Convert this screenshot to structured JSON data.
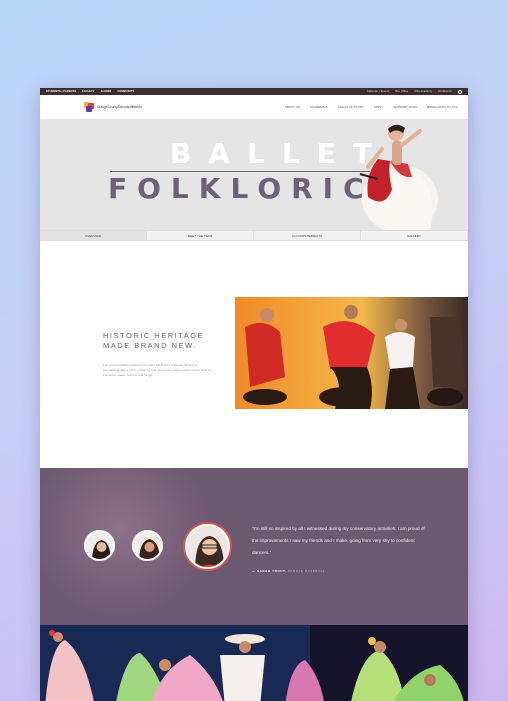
{
  "util_bar": {
    "left": [
      "Students | Parents",
      "Faculty",
      "Alumni",
      "Community"
    ],
    "right": [
      "Calendar / Events",
      "Box Office",
      "OSA Academy",
      "Workbench"
    ]
  },
  "nav": {
    "logo_text": "OrangeCountySchoolsoftheArts",
    "links": [
      "About Us",
      "Academics",
      "Areas of Study",
      "Apply",
      "Support OCSA",
      "Bring OCSA to You"
    ]
  },
  "hero": {
    "title_line1": "BALLET",
    "title_line2": "FOLKLORICO"
  },
  "tabs": [
    "Overview",
    "Meet the Team",
    "Accomplishments",
    "Gallery"
  ],
  "heritage": {
    "heading_line1": "Historic Heritage",
    "heading_line2": "Made Brand New.",
    "body": "The enriched Ballet Folklorico Program will feature a diverse offering of international dance forms, including and other Latin-inspired dance forms such as Flamenco, Salsa, Samba, and Tango."
  },
  "testimonial": {
    "quote": "“I'm still so inspired by all I witnessed during my conservatory activities. I am proud of the improvements I saw my friends and I make, going from very shy to confident dancers.”",
    "author": "— Sarah Trout,",
    "role": "Parole Baseball"
  },
  "colors": {
    "accent": "#6d6178",
    "testimonial_bg": "#6d5872",
    "util_bar": "#3a2f2e"
  }
}
